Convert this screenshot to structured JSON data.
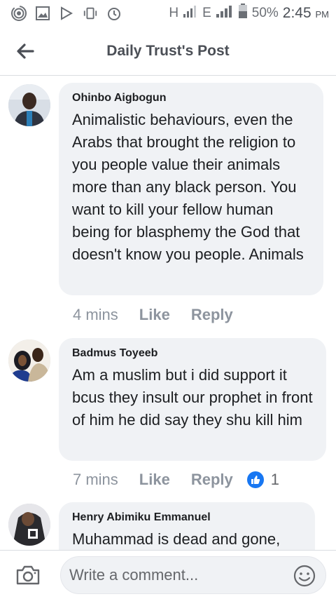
{
  "status_bar": {
    "network": "H",
    "network2": "E",
    "battery": "50%",
    "time": "2:45",
    "ampm": "PM"
  },
  "header": {
    "title": "Daily Trust's Post"
  },
  "comments": [
    {
      "author": "Ohinbo Aigbogun",
      "text": "Animalistic behaviours, even the Arabs that brought the religion to you people value their animals more than any black person. You want to kill your fellow human being for blasphemy the God that doesn't know you people. Animals",
      "time": "4 mins",
      "like_label": "Like",
      "reply_label": "Reply"
    },
    {
      "author": "Badmus Toyeeb",
      "text": "Am a muslim but i did support it bcus they insult our prophet in front of him  he did say they shu kill him",
      "time": "7 mins",
      "like_label": "Like",
      "reply_label": "Reply",
      "reaction_count": "1"
    },
    {
      "author": "Henry Abimiku Emmanuel",
      "text": "Muhammad is dead and gone,"
    }
  ],
  "composer": {
    "placeholder": "Write a comment..."
  },
  "colors": {
    "accent": "#1877f2",
    "bubble": "#f0f2f5",
    "muted": "#8d949e"
  }
}
